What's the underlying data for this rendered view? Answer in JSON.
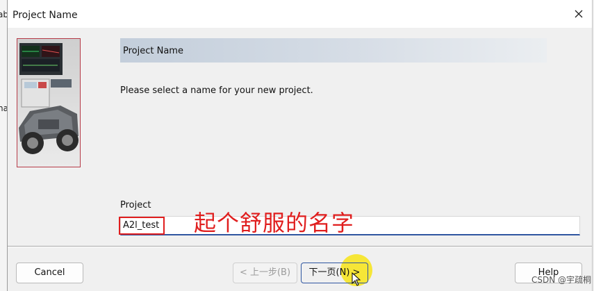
{
  "background_window": {
    "fragments": [
      "ab",
      "ha"
    ]
  },
  "dialog": {
    "title": "Project Name",
    "banner_title": "Project Name",
    "instruction": "Please select a name for your new project.",
    "project_label": "Project",
    "project_value": "A2l_test",
    "annotation": "起个舒服的名字"
  },
  "buttons": {
    "cancel": "Cancel",
    "back": "< 上一步(B)",
    "next": "下一页(N) >",
    "help": "Help"
  },
  "watermark": "CSDN @宇疏桐",
  "colors": {
    "annotation_red": "#e01e1e",
    "focus_blue": "#2e55a0",
    "cursor_highlight": "#f6e41c"
  }
}
